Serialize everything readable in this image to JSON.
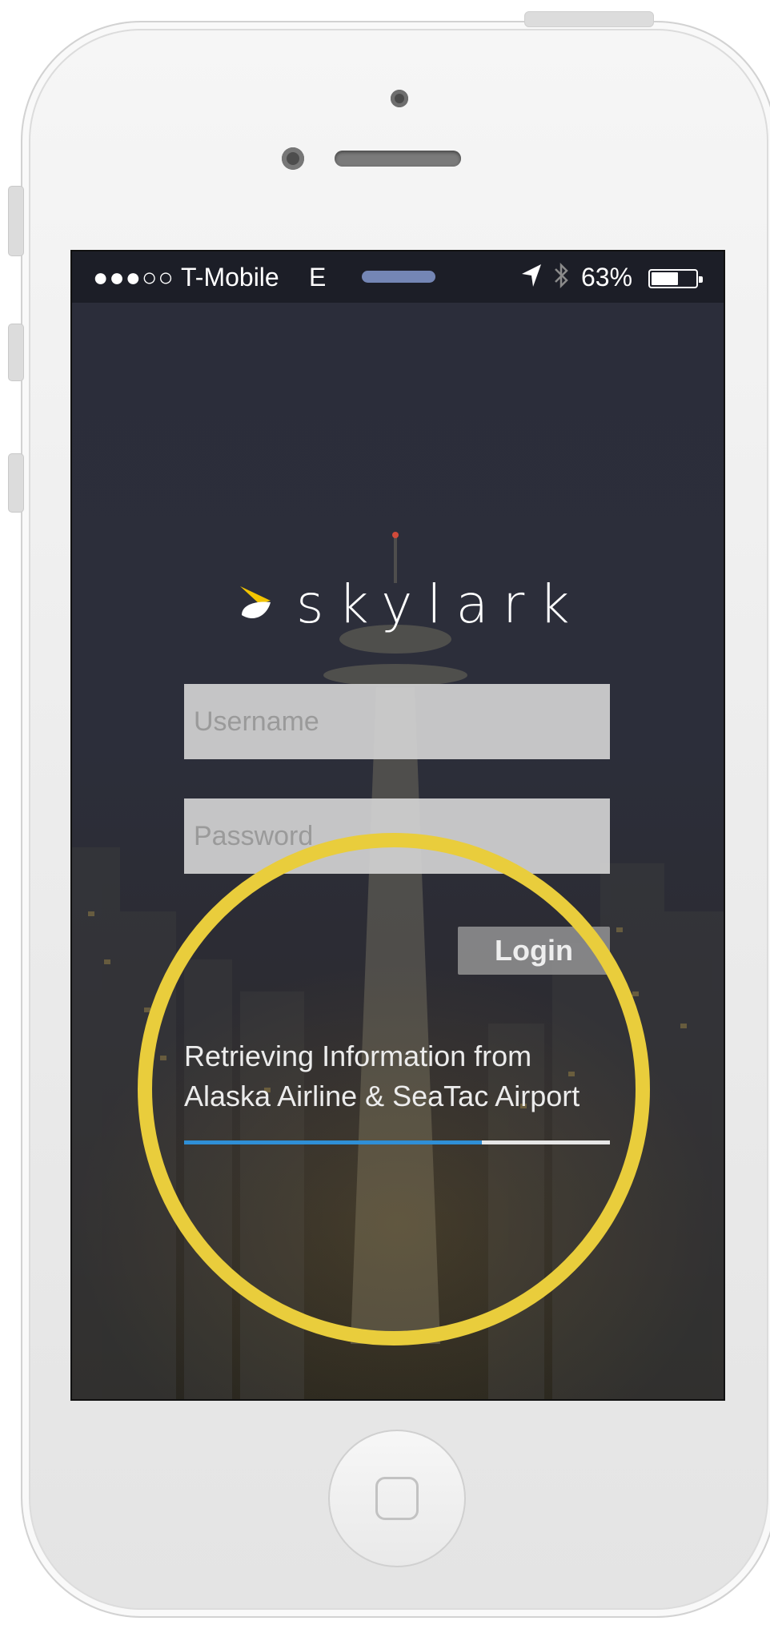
{
  "status_bar": {
    "signal": "●●●○○",
    "carrier": "T-Mobile",
    "network": "E",
    "battery_percent": "63%",
    "battery_level": 0.63
  },
  "brand": {
    "name": "skylark"
  },
  "form": {
    "username_placeholder": "Username",
    "password_placeholder": "Password",
    "login_label": "Login"
  },
  "loading": {
    "line1": "Retrieving Information from",
    "line2": "Alaska Airline & SeaTac Airport",
    "progress": 0.7
  },
  "colors": {
    "accent_blue": "#2f8fd6",
    "highlight_yellow": "#e9cd3c"
  }
}
